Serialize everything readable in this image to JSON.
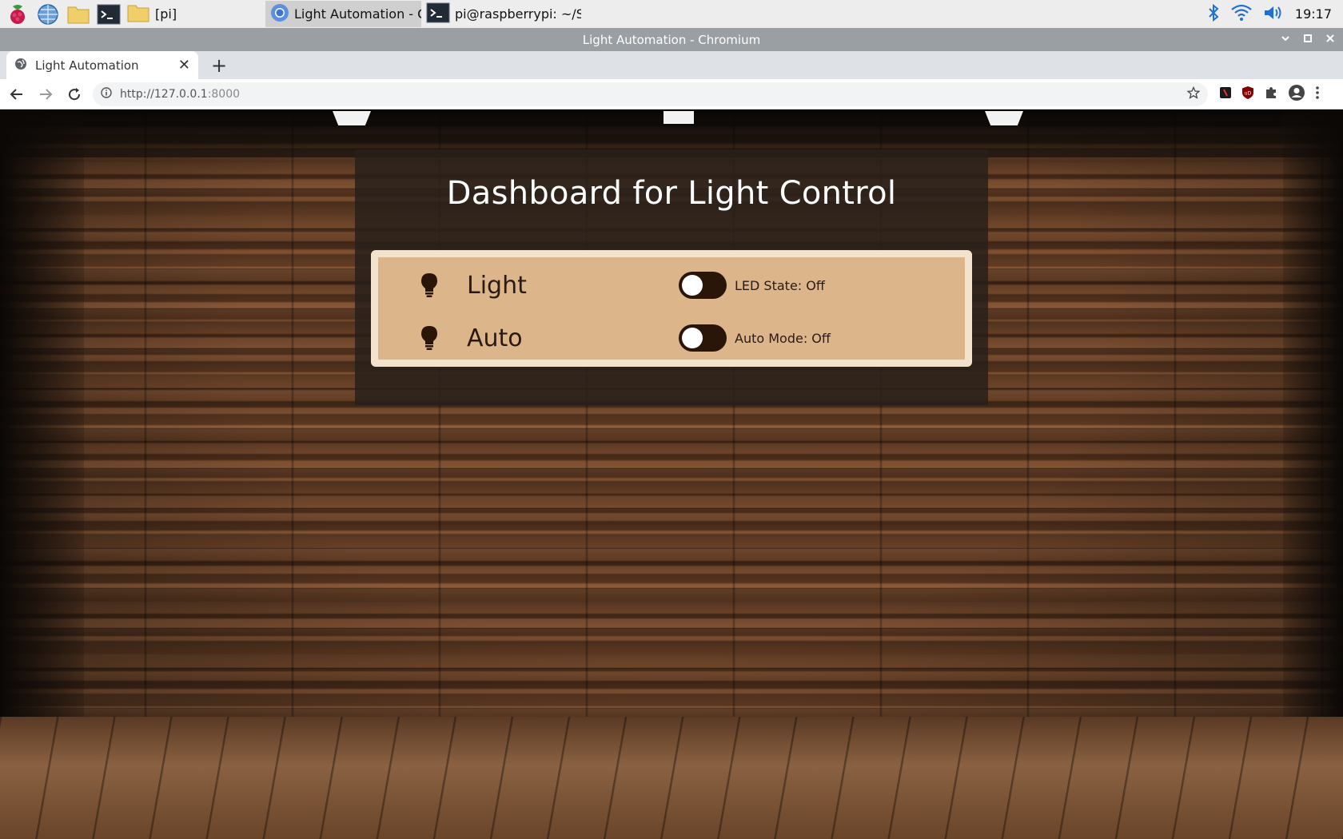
{
  "taskbar": {
    "tasks": [
      {
        "label": "[pi]"
      },
      {
        "label": "Light Automation - C..."
      },
      {
        "label": "pi@raspberrypi: ~/SO..."
      }
    ],
    "clock": "19:17"
  },
  "window": {
    "title": "Light Automation - Chromium"
  },
  "browser": {
    "tab_title": "Light Automation",
    "url_host": "http://127.0.0.1",
    "url_port": ":8000"
  },
  "page": {
    "title": "Dashboard for Light Control",
    "rows": [
      {
        "label": "Light",
        "state_text": "LED State: Off",
        "on": false
      },
      {
        "label": "Auto",
        "state_text": "Auto Mode: Off",
        "on": false
      }
    ]
  },
  "colors": {
    "card_bg": "#dcb68a",
    "card_border": "#f3e2cc",
    "toggle_off": "#2a1608"
  }
}
